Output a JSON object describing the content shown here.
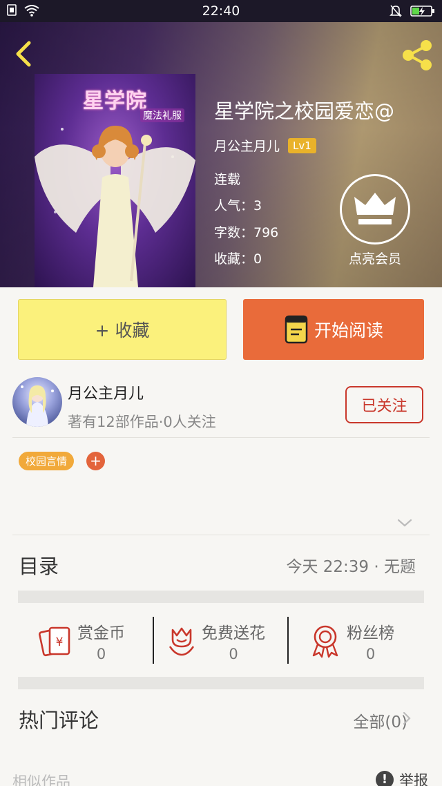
{
  "status_bar": {
    "time": "22:40"
  },
  "book": {
    "title": "星学院之校园爱恋@",
    "author": "月公主月儿",
    "level": "Lv1",
    "status": "连载",
    "popularity": "人气：3",
    "word_count": "字数：796",
    "favorites": "收藏：0",
    "cover_title": "星学院",
    "cover_subtitle": "魔法礼服"
  },
  "vip": {
    "label": "点亮会员"
  },
  "actions": {
    "collect_label": "+ 收藏",
    "read_label": "开始阅读"
  },
  "author_card": {
    "name": "月公主月儿",
    "meta": "著有12部作品·0人关注",
    "follow_label": "已关注"
  },
  "tags": [
    {
      "label": "校园言情"
    }
  ],
  "tag_add": "+",
  "catalog": {
    "label": "目录",
    "latest": "今天 22:39 · 无题"
  },
  "rewards": [
    {
      "label": "赏金币",
      "count": "0",
      "icon": "red-envelope-icon"
    },
    {
      "label": "免费送花",
      "count": "0",
      "icon": "flower-icon"
    },
    {
      "label": "粉丝榜",
      "count": "0",
      "icon": "award-ribbon-icon"
    }
  ],
  "hot_comments": {
    "label": "热门评论",
    "all": "全部(0)"
  },
  "similar": {
    "label": "相似作品"
  },
  "report": {
    "label": "举报",
    "icon_char": "!"
  },
  "colors": {
    "accent_orange": "#e96b3a",
    "collect_yellow": "#fbf17c",
    "follow_red": "#c9372b",
    "tag_orange": "#f1a93a",
    "level_gold": "#e9b22a"
  }
}
